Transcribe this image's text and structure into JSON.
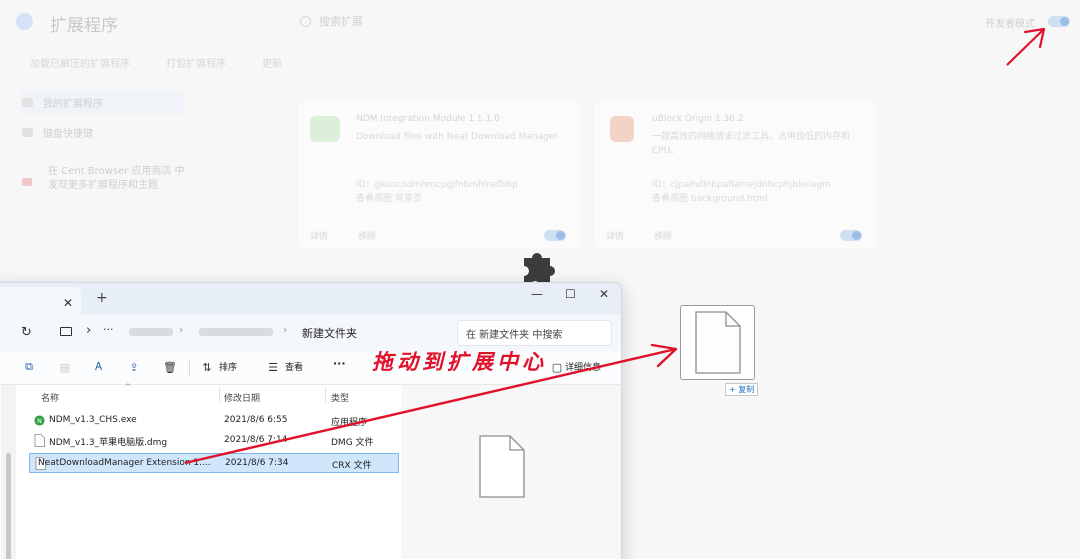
{
  "extensions_page": {
    "title": "扩展程序",
    "search_placeholder": "搜索扩展",
    "dev_mode_label": "开发者模式",
    "tabs": [
      "加载已解压的扩展程序",
      "打包扩展程序",
      "更新"
    ],
    "sidebar": [
      {
        "label": "我的扩展程序"
      },
      {
        "label": "键盘快捷键"
      }
    ],
    "store_text": "在 Cent Browser 应用商店 中发现更多扩展程序和主题",
    "cards": [
      {
        "name": "NDM Integration Module 1.1.1.0",
        "description": "Download files with Neat Download Manager",
        "id": "ID：gkoncodmhmcpgjfnbmhlnefbhp",
        "view": "查看视图 背景页",
        "btn_details": "详情",
        "btn_remove": "移除"
      },
      {
        "name": "uBlock Origin 1.36.2",
        "description": "一款高效的网络请求过滤工具，占用极低的内存和 CPU。",
        "id": "ID：cjpalhdlnbpafiamejdnhcphjbkeiagm",
        "view": "查看视图 background.html",
        "btn_details": "详情",
        "btn_remove": "移除"
      }
    ]
  },
  "drag_ghost": {
    "copy_label": "+ 复制"
  },
  "explorer": {
    "tab_close": "✕",
    "tab_add": "+",
    "window_controls": [
      "—",
      "☐",
      "✕"
    ],
    "refresh": "↻",
    "crumb_arrow": "›",
    "crumb_more": "···",
    "crumb_sep": "›",
    "current_folder": "新建文件夹",
    "search_placeholder": "在 新建文件夹 中搜索",
    "toolbar": {
      "sort": "排序",
      "view": "查看",
      "more": "···",
      "details": "详细信息"
    },
    "columns": [
      "名称",
      "修改日期",
      "类型"
    ],
    "files": [
      {
        "name": "NDM_v1.3_CHS.exe",
        "date": "2021/8/6 6:55",
        "type": "应用程序",
        "selected": false
      },
      {
        "name": "NDM_v1.3_苹果电脑版.dmg",
        "date": "2021/8/6 7:14",
        "type": "DMG 文件",
        "selected": false
      },
      {
        "name": "NeatDownloadManager Extension 1....",
        "date": "2021/8/6 7:34",
        "type": "CRX 文件",
        "selected": true
      }
    ]
  },
  "annotation": {
    "text": "拖动到扩展中心",
    "color": "#e0122a"
  }
}
